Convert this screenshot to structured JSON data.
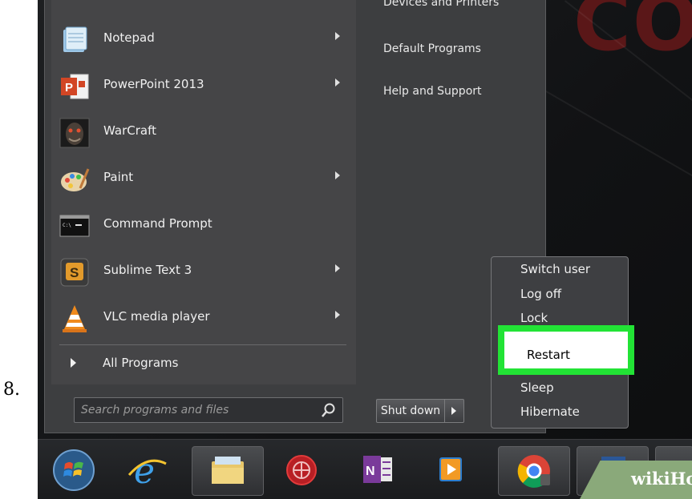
{
  "step_number": "8.",
  "desktop": {
    "background_text": "CO"
  },
  "start_menu": {
    "top_partial_item": "Devices and Printers",
    "programs": [
      {
        "label": "Notepad",
        "icon": "notepad-icon",
        "has_submenu": true
      },
      {
        "label": "PowerPoint 2013",
        "icon": "powerpoint-icon",
        "has_submenu": true
      },
      {
        "label": "WarCraft",
        "icon": "warcraft-icon",
        "has_submenu": false
      },
      {
        "label": "Paint",
        "icon": "paint-icon",
        "has_submenu": true
      },
      {
        "label": "Command Prompt",
        "icon": "command-prompt-icon",
        "has_submenu": false
      },
      {
        "label": "Sublime Text 3",
        "icon": "sublime-text-icon",
        "has_submenu": true
      },
      {
        "label": "VLC media player",
        "icon": "vlc-icon",
        "has_submenu": true
      }
    ],
    "all_programs_label": "All Programs",
    "search_placeholder": "Search programs and files",
    "places": [
      "Devices and Printers",
      "Default Programs",
      "Help and Support"
    ],
    "shutdown_label": "Shut down"
  },
  "power_menu": {
    "items": [
      "Switch user",
      "Log off",
      "Lock",
      "Restart",
      "Sleep",
      "Hibernate"
    ],
    "highlighted": "Restart",
    "highlight_color": "#22e335"
  },
  "taskbar": {
    "items": [
      "start-orb-icon",
      "internet-explorer-icon",
      "file-explorer-icon",
      "security-app-icon",
      "onenote-icon",
      "media-player-icon",
      "chrome-icon",
      "word-icon",
      "powerpoint-icon"
    ]
  },
  "watermark": {
    "part1": "wiki",
    "part2": "How"
  },
  "colors": {
    "menu_bg": "#3d3e40",
    "accent_green": "#22e335",
    "desktop_text": "#5a1718"
  }
}
